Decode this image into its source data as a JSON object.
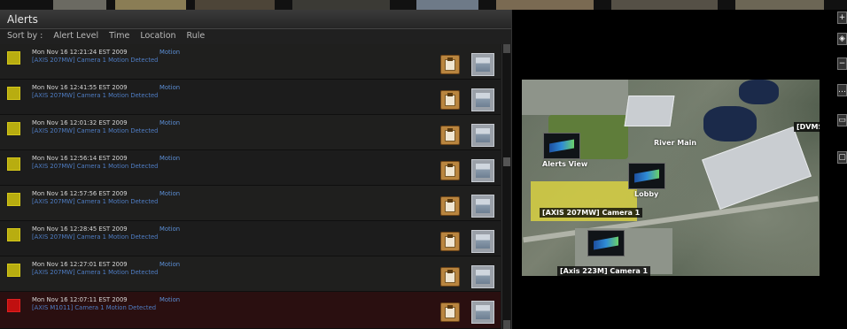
{
  "panel": {
    "title": "Alerts",
    "sort_label": "Sort by :",
    "sort_options": [
      "Alert Level",
      "Time",
      "Location",
      "Rule"
    ]
  },
  "alerts": [
    {
      "level": "yellow",
      "time": "Mon Nov 16 12:21:24 EST 2009",
      "type": "Motion",
      "desc": "[AXIS 207MW] Camera 1 Motion Detected"
    },
    {
      "level": "yellow",
      "time": "Mon Nov 16 12:41:55 EST 2009",
      "type": "Motion",
      "desc": "[AXIS 207MW] Camera 1 Motion Detected"
    },
    {
      "level": "yellow",
      "time": "Mon Nov 16 12:01:32 EST 2009",
      "type": "Motion",
      "desc": "[AXIS 207MW] Camera 1 Motion Detected"
    },
    {
      "level": "yellow",
      "time": "Mon Nov 16 12:56:14 EST 2009",
      "type": "Motion",
      "desc": "[AXIS 207MW] Camera 1 Motion Detected"
    },
    {
      "level": "yellow",
      "time": "Mon Nov 16 12:57:56 EST 2009",
      "type": "Motion",
      "desc": "[AXIS 207MW] Camera 1 Motion Detected"
    },
    {
      "level": "yellow",
      "time": "Mon Nov 16 12:28:45 EST 2009",
      "type": "Motion",
      "desc": "[AXIS 207MW] Camera 1 Motion Detected"
    },
    {
      "level": "yellow",
      "time": "Mon Nov 16 12:27:01 EST 2009",
      "type": "Motion",
      "desc": "[AXIS 207MW] Camera 1 Motion Detected"
    },
    {
      "level": "red",
      "time": "Mon Nov 16 12:07:11 EST 2009",
      "type": "Motion",
      "desc": "[AXIS M1011] Camera 1 Motion Detected"
    }
  ],
  "map": {
    "labels": {
      "dvms": "[DVMS Au",
      "river": "River Main",
      "alerts_view": "Alerts View",
      "lobby": "Lobby",
      "axis207": "[AXIS 207MW] Camera 1",
      "axis223": "[Axis 223M] Camera 1"
    },
    "tools": [
      "+",
      "◈",
      "−",
      "…",
      "▭",
      "▢"
    ]
  },
  "colors": {
    "yellow_level": "#b8ad10",
    "red_level": "#c01010",
    "link_blue": "#4f7dc4"
  },
  "icons": {
    "clip": "clipboard-icon",
    "snap": "snapshot-icon"
  }
}
